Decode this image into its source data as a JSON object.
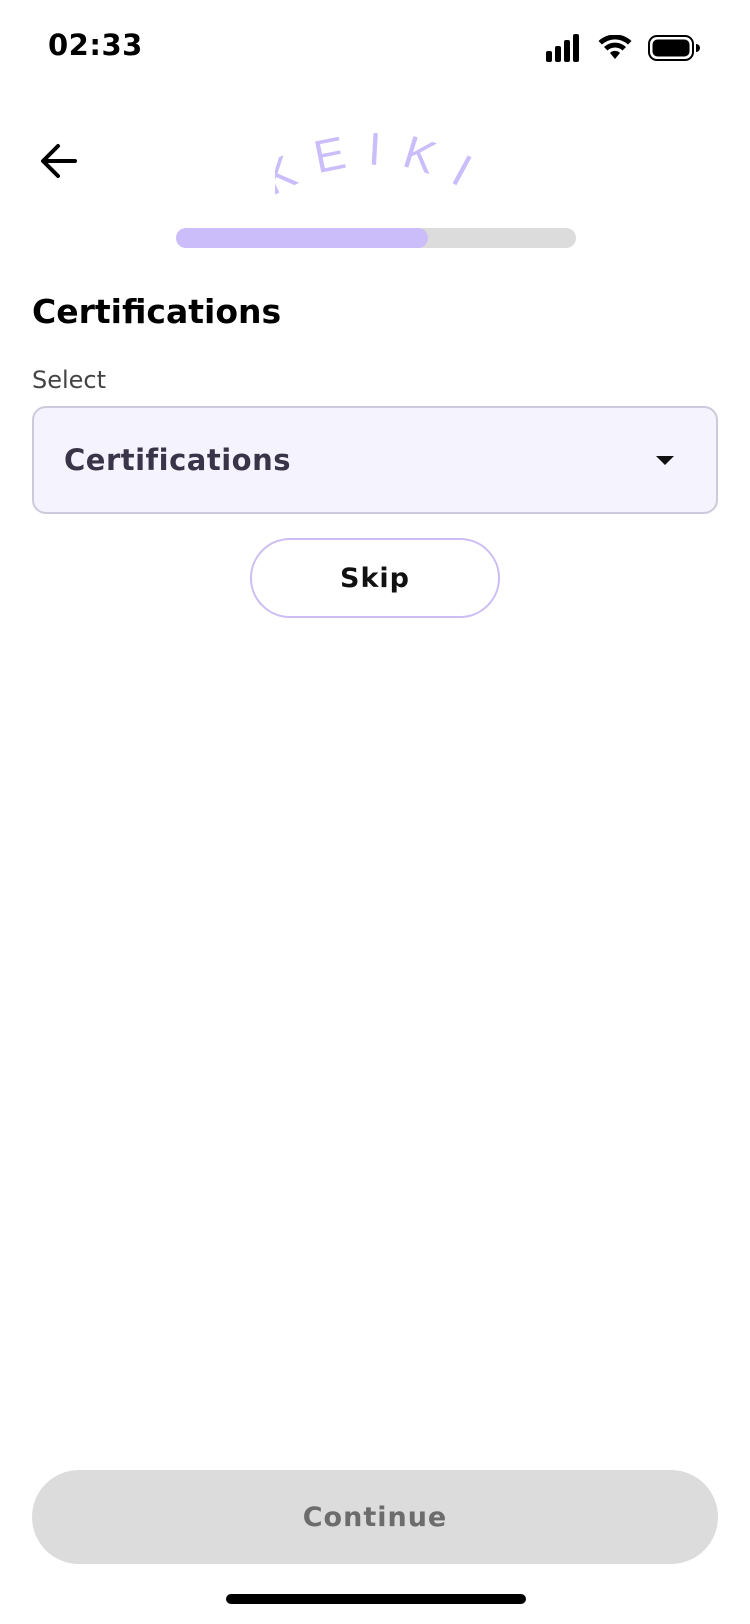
{
  "status_bar": {
    "time": "02:33",
    "icons": [
      "signal-icon",
      "wifi-icon",
      "battery-icon"
    ]
  },
  "header": {
    "back_icon": "arrow-left-icon",
    "logo_text": "KEIKI",
    "logo_color": "#cbbdf9"
  },
  "progress": {
    "fraction": 0.63,
    "fill_color": "#cbbdf9",
    "track_color": "#dcdcdc"
  },
  "main": {
    "title": "Certifications",
    "field_label": "Select",
    "select": {
      "value": "Certifications",
      "icon": "caret-down-icon"
    },
    "skip_label": "Skip"
  },
  "footer": {
    "continue_label": "Continue"
  },
  "colors": {
    "accent": "#cbbdf9",
    "select_background": "#f5f3fd",
    "disabled_button": "#dcdcdc"
  }
}
